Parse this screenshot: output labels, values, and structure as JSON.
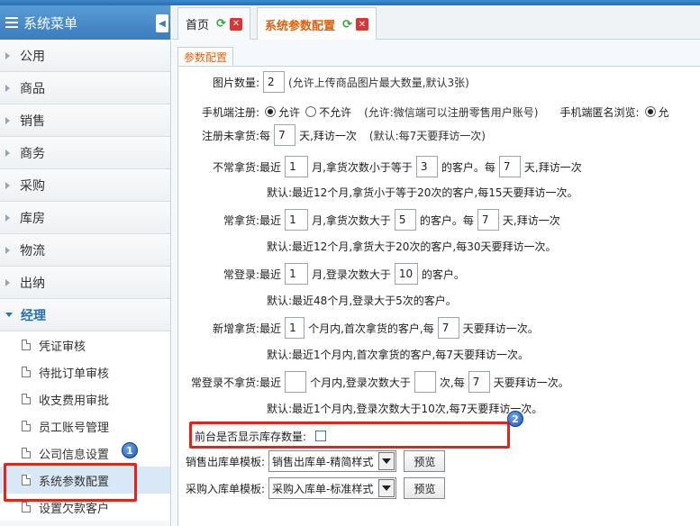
{
  "sidebar": {
    "title": "系统菜单",
    "categories": [
      {
        "label": "公用"
      },
      {
        "label": "商品"
      },
      {
        "label": "销售"
      },
      {
        "label": "商务"
      },
      {
        "label": "采购"
      },
      {
        "label": "库房"
      },
      {
        "label": "物流"
      },
      {
        "label": "出纳"
      },
      {
        "label": "经理"
      }
    ],
    "subitems": [
      {
        "label": "凭证审核"
      },
      {
        "label": "待批订单审核"
      },
      {
        "label": "收支费用审批"
      },
      {
        "label": "员工账号管理"
      },
      {
        "label": "公司信息设置"
      },
      {
        "label": "系统参数配置"
      },
      {
        "label": "设置欠款客户"
      }
    ]
  },
  "tabs": [
    {
      "label": "首页"
    },
    {
      "label": "系统参数配置"
    }
  ],
  "subtab": "参数配置",
  "form": {
    "img_count": {
      "label": "图片数量:",
      "value": "2",
      "hint": "(允许上传商品图片最大数量,默认3张)"
    },
    "mobile_reg": {
      "label": "手机端注册:",
      "opt_allow": "允许",
      "opt_deny": "不允许",
      "hint": "(允许:微信端可以注册零售用户账号)",
      "anon_label": "手机端匿名浏览:",
      "anon_opt": "允"
    },
    "reg_no_order": {
      "label": "注册未拿货:",
      "pre": "每",
      "value": "7",
      "post": "天,拜访一次",
      "hint": "(默认:每7天要拜访一次)"
    },
    "irregular": {
      "label": "不常拿货:",
      "t1": "最近",
      "v1": "1",
      "t2": "月,拿货次数小于等于",
      "v2": "3",
      "t3": "的客户。每",
      "v3": "7",
      "t4": "天,拜访一次",
      "default": "默认:最近12个月,拿货小于等于20次的客户,每15天要拜访一次。"
    },
    "regular": {
      "label": "常拿货:",
      "t1": "最近",
      "v1": "1",
      "t2": "月,拿货次数大于",
      "v2": "5",
      "t3": "的客户。每",
      "v3": "7",
      "t4": "天,拜访一次",
      "default": "默认:最近12个月,拿货大于20次的客户,每30天要拜访一次。"
    },
    "login": {
      "label": "常登录:",
      "t1": "最近",
      "v1": "1",
      "t2": "月,登录次数大于",
      "v2": "10",
      "t3": "的客户。",
      "default": "默认:最近48个月,登录大于5次的客户。"
    },
    "new_order": {
      "label": "新增拿货:",
      "t1": "最近",
      "v1": "1",
      "t2": "个月内,首次拿货的客户,每",
      "v2": "7",
      "t3": "天要拜访一次。",
      "default": "默认:最近1个月内,首次拿货的客户,每7天要拜访一次。"
    },
    "login_no_order": {
      "label": "常登录不拿货:",
      "t1": "最近",
      "v1": "",
      "t2": "个月内,登录次数大于",
      "v2": "",
      "t3": "次,每",
      "v3": "7",
      "t4": "天要拜访一次。",
      "default": "默认:最近1个月内,登录次数大于10次,每7天要拜访一次。"
    },
    "show_stock": {
      "label": "前台是否显示库存数量:"
    },
    "sales_tpl": {
      "label": "销售出库单模板:",
      "value": "销售出库单-精简样式",
      "button": "预览"
    },
    "purchase_tpl": {
      "label": "采购入库单模板:",
      "value": "采购入库单-标准样式",
      "button": "预览"
    }
  },
  "badges": {
    "b1": "1",
    "b2": "2"
  }
}
